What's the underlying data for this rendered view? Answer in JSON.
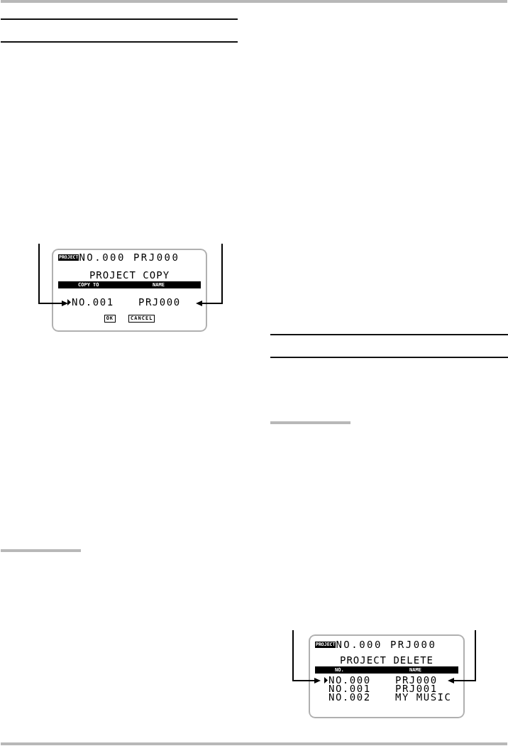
{
  "screens": [
    {
      "mode_label": "PROJECT",
      "info": "NO.000 PRJ000",
      "title": "PROJECT COPY",
      "columns": [
        "COPY TO",
        "NAME"
      ],
      "rows": [
        {
          "cells": [
            "NO.001",
            "PRJ000"
          ],
          "selected": true
        }
      ],
      "buttons": [
        "OK",
        "CANCEL"
      ]
    },
    {
      "mode_label": "PROJECT",
      "info": "NO.000 PRJ000",
      "title": "PROJECT DELETE",
      "columns": [
        "NO.",
        "NAME"
      ],
      "rows": [
        {
          "cells": [
            "NO.000",
            "PRJ000"
          ],
          "selected": true
        },
        {
          "cells": [
            "NO.001",
            "PRJ001"
          ],
          "selected": false
        },
        {
          "cells": [
            "NO.002",
            "MY MUSIC"
          ],
          "selected": false
        }
      ]
    }
  ]
}
